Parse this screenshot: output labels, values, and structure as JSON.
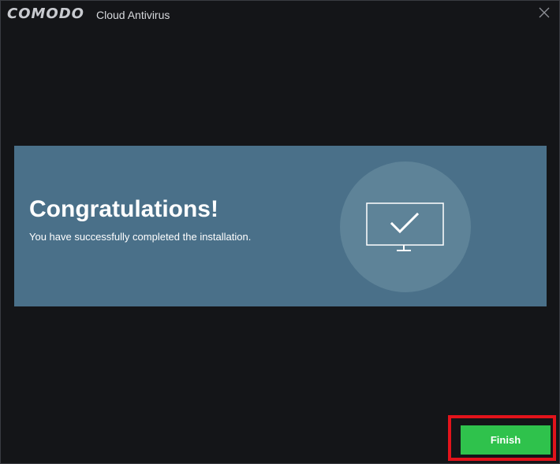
{
  "titlebar": {
    "brand": "COMODO",
    "product": "Cloud Antivirus",
    "close_icon": "close-icon"
  },
  "banner": {
    "headline": "Congratulations!",
    "message": "You have successfully completed the installation.",
    "illustration_icon": "monitor-check-icon"
  },
  "footer": {
    "finish_label": "Finish"
  },
  "colors": {
    "background": "#141518",
    "banner": "#4a7089",
    "circle": "#5e8398",
    "finish_button": "#2fc24c",
    "highlight_border": "#e3131b"
  }
}
